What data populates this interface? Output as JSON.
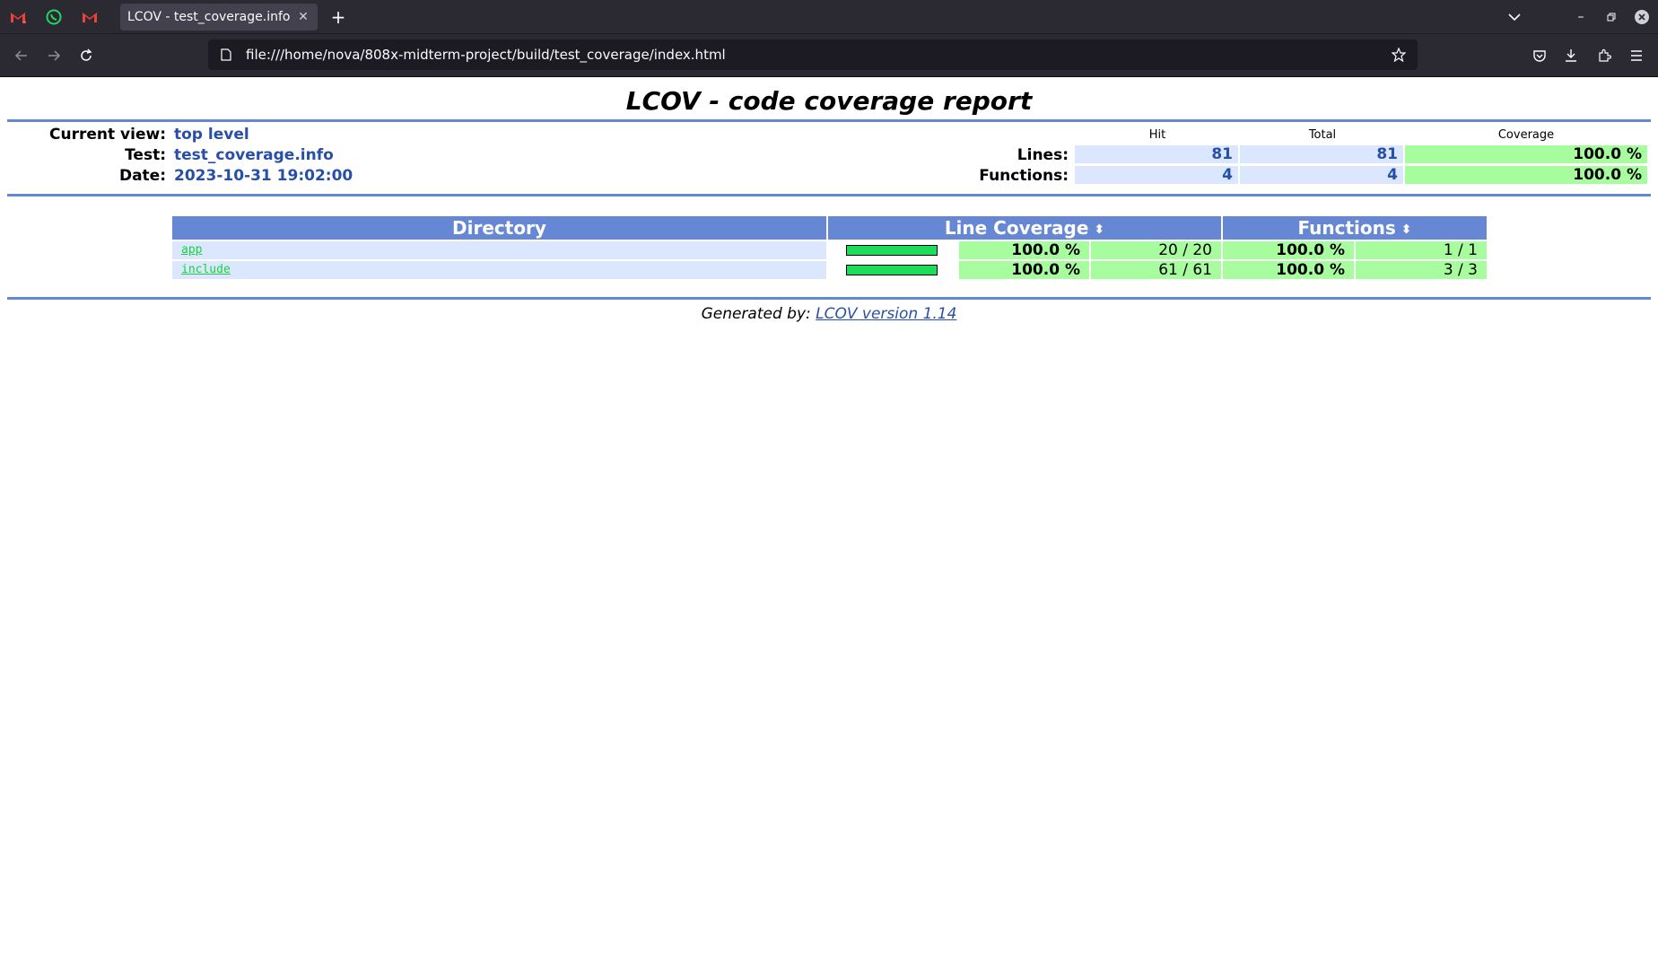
{
  "browser": {
    "tab_title": "LCOV - test_coverage.info",
    "url": "file:///home/nova/808x-midterm-project/build/test_coverage/index.html",
    "pinned_tabs": [
      "gmail-icon",
      "whatsapp-icon",
      "gmail-icon"
    ]
  },
  "report": {
    "title": "LCOV - code coverage report",
    "current_view_label": "Current view:",
    "current_view": "top level",
    "test_label": "Test:",
    "test": "test_coverage.info",
    "date_label": "Date:",
    "date": "2023-10-31 19:02:00",
    "summary": {
      "hit_header": "Hit",
      "total_header": "Total",
      "coverage_header": "Coverage",
      "rows": [
        {
          "label": "Lines:",
          "hit": "81",
          "total": "81",
          "coverage": "100.0 %"
        },
        {
          "label": "Functions:",
          "hit": "4",
          "total": "4",
          "coverage": "100.0 %"
        }
      ]
    },
    "table": {
      "headers": {
        "directory": "Directory",
        "line_coverage": "Line Coverage",
        "functions": "Functions"
      },
      "rows": [
        {
          "name": "app",
          "line_pct": "100.0 %",
          "line_cnt": "20 / 20",
          "func_pct": "100.0 %",
          "func_cnt": "1 / 1",
          "bar_fraction": 1.0
        },
        {
          "name": "include",
          "line_pct": "100.0 %",
          "line_cnt": "61 / 61",
          "func_pct": "100.0 %",
          "func_cnt": "3 / 3",
          "bar_fraction": 1.0
        }
      ]
    },
    "footer_prefix": "Generated by:",
    "footer_link": "LCOV version 1.14"
  },
  "colors": {
    "header_blue": "#6688d4",
    "value_blue": "#284fa8",
    "hit_bg": "#dae7fe",
    "coverage_green": "#a7fc9d",
    "bar_green": "#1ddc5b"
  }
}
